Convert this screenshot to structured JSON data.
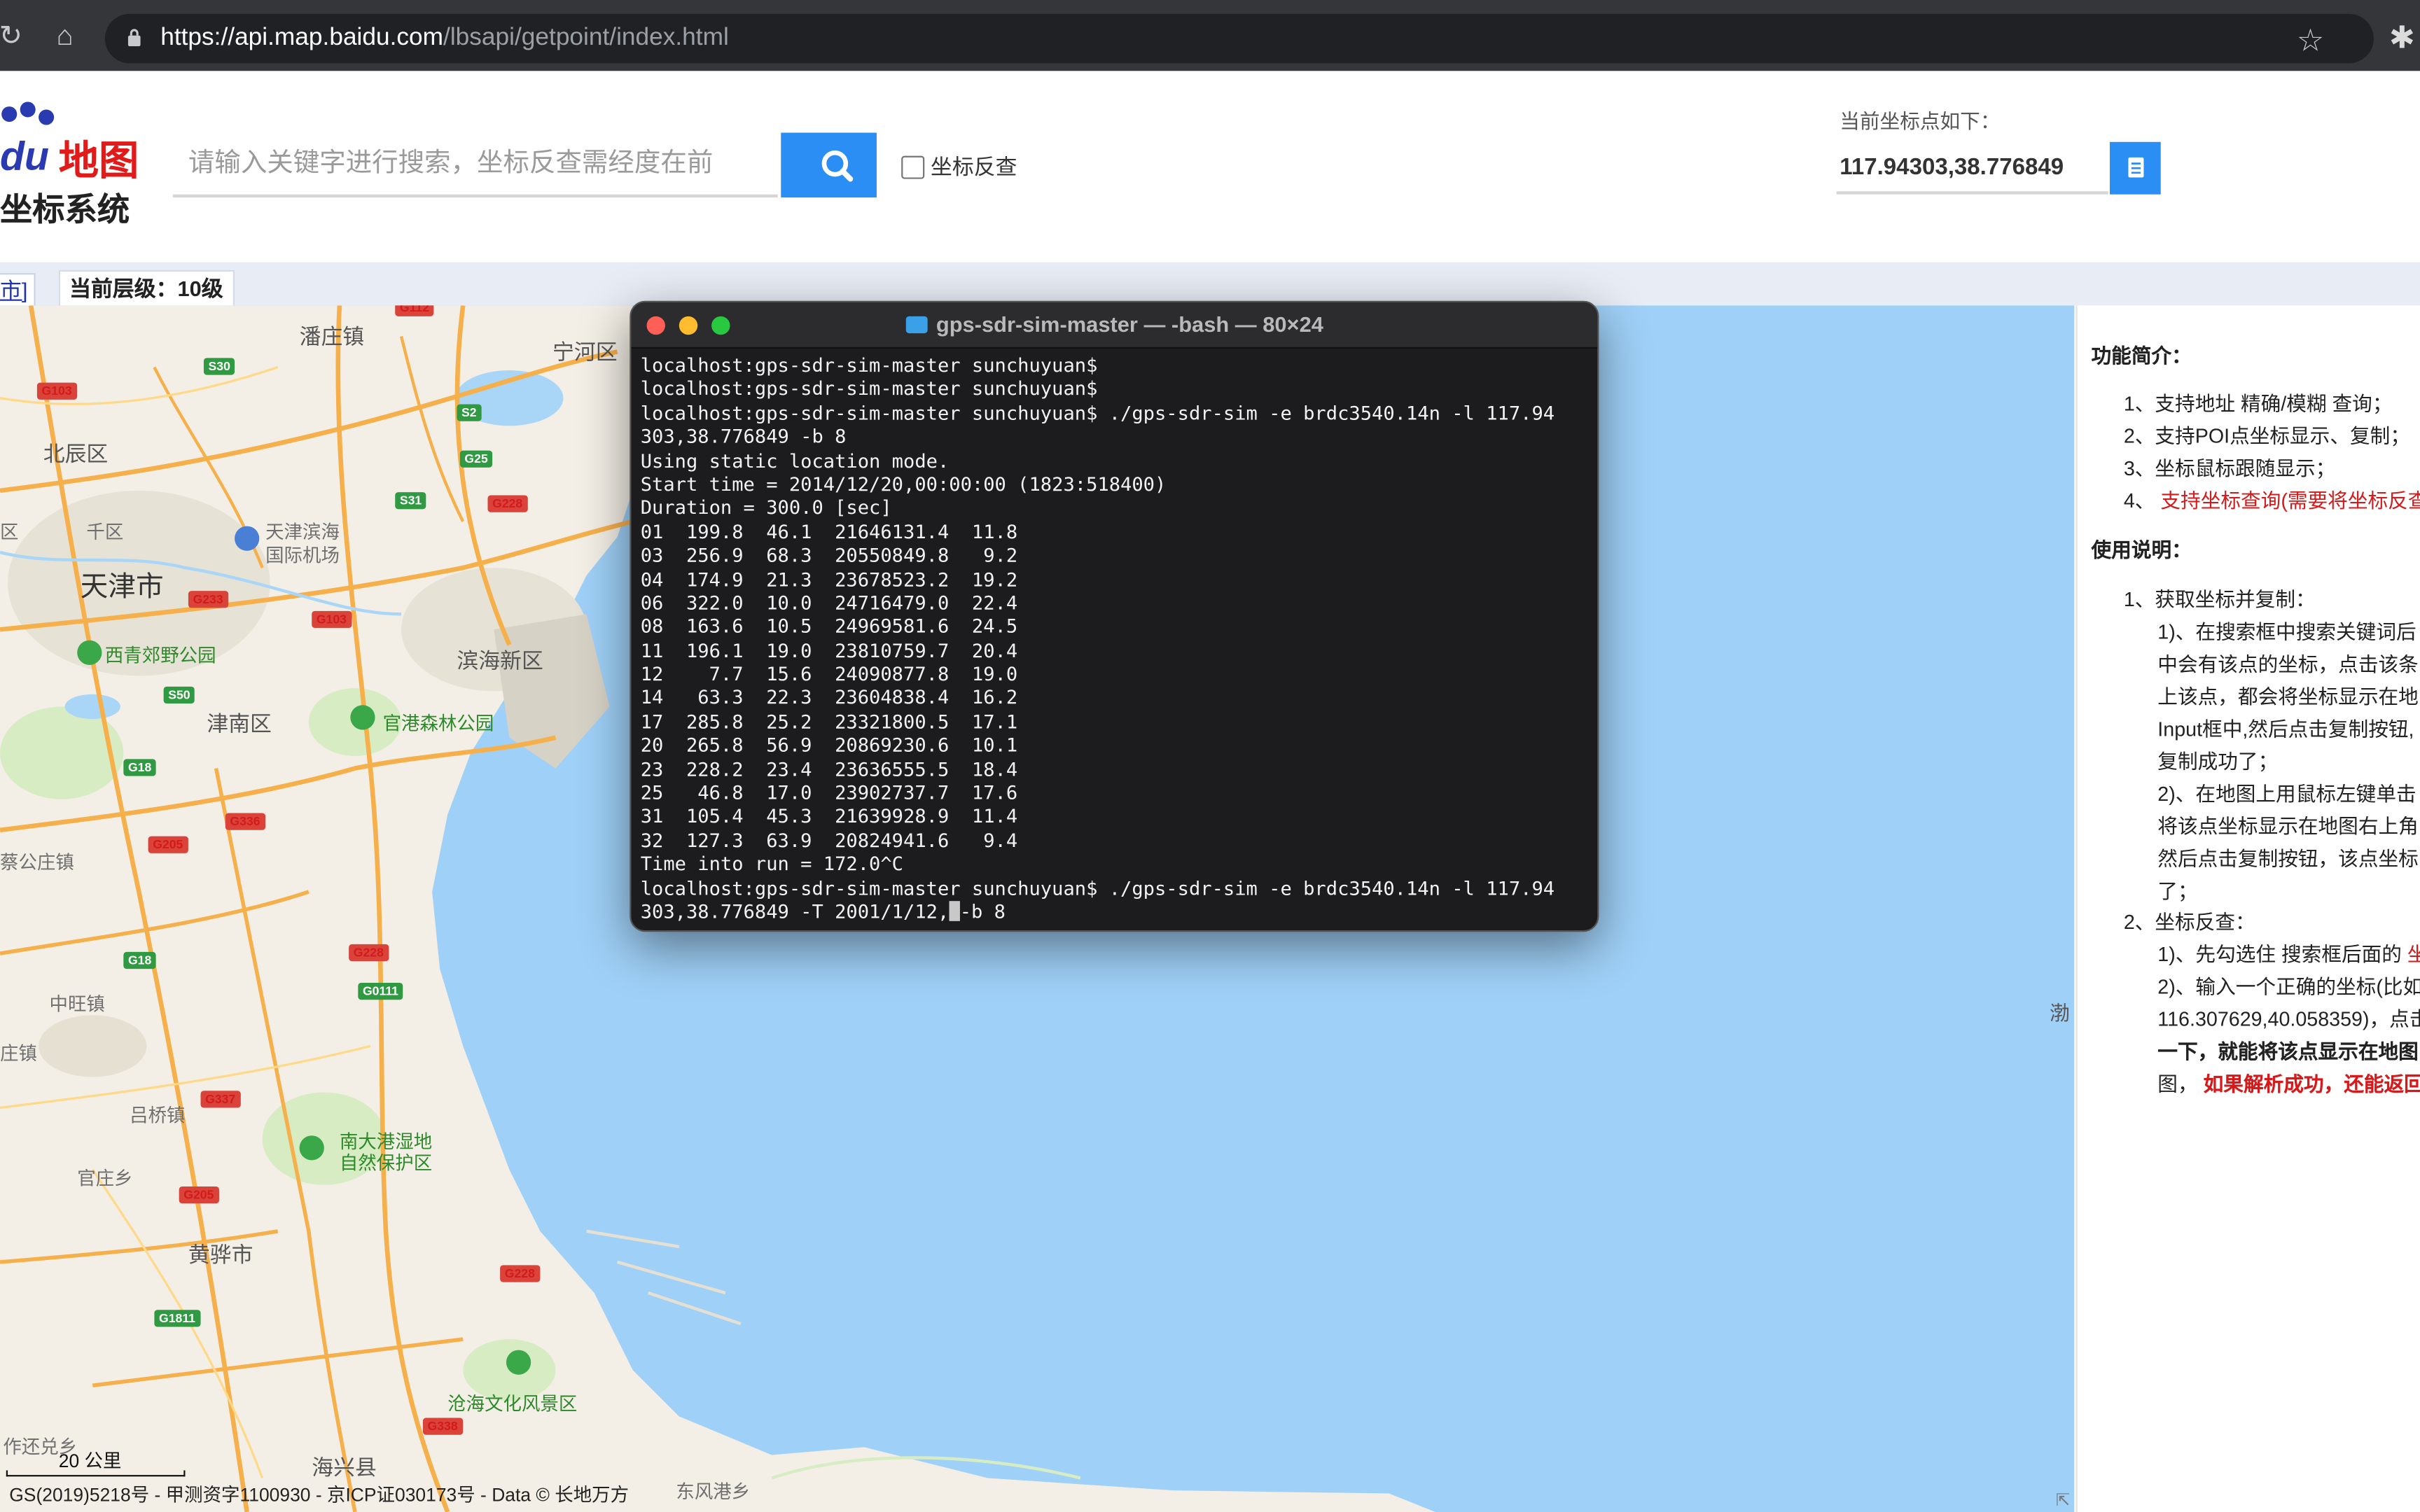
{
  "browser": {
    "url_domain": "https://api.map.baidu.com",
    "url_path": "/lbsapi/getpoint/index.html"
  },
  "header": {
    "logo_du": "du",
    "logo_map": "地图",
    "logo_sub": "坐标系统",
    "search_placeholder": "请输入关键字进行搜索，坐标反查需经度在前",
    "reverse_label": "坐标反查",
    "coord_title": "当前坐标点如下：",
    "coord_value": "117.94303,38.776849"
  },
  "levelbar": {
    "city_link": "市]",
    "level_label": "当前层级：10级"
  },
  "map": {
    "labels": {
      "tianjin": "天津市",
      "panzhuang": "潘庄镇",
      "ninghe": "宁河区",
      "beichen": "北辰区",
      "xiqing_area": "区",
      "gangu": "千区",
      "airport1": "天津滨海",
      "airport2": "国际机场",
      "xiqing_park": "西青郊野公园",
      "binhai": "滨海新区",
      "jinnan": "津南区",
      "guangang": "官港森林公园",
      "caigongzhuang": "蔡公庄镇",
      "zhongwang": "中旺镇",
      "zhen": "庄镇",
      "lvqiao": "吕桥镇",
      "nandagang1": "南大港湿地",
      "nandagang2": "自然保护区",
      "guanzhuang": "官庄乡",
      "huanghua": "黄骅市",
      "cangzhou_culture": "沧海文化风景区",
      "zuowang": "作还兑乡",
      "haixing": "海兴县",
      "fengang": "东风港乡"
    },
    "shields": [
      "G112",
      "S30",
      "G103",
      "S2",
      "G25",
      "S31",
      "G228",
      "G233",
      "G103",
      "S50",
      "G18",
      "G205",
      "G336",
      "G228",
      "G18",
      "G0111",
      "G337",
      "G205",
      "G228",
      "G1811",
      "G338"
    ],
    "scale_label": "20 公里",
    "copyright": "GS(2019)5218号 - 甲测资字1100930 - 京ICP证030173号 - Data © 长地万方",
    "bohai": "渤"
  },
  "terminal": {
    "title": "gps-sdr-sim-master — -bash — 80×24",
    "lines": [
      "localhost:gps-sdr-sim-master sunchuyuan$",
      "localhost:gps-sdr-sim-master sunchuyuan$",
      "localhost:gps-sdr-sim-master sunchuyuan$ ./gps-sdr-sim -e brdc3540.14n -l 117.94",
      "303,38.776849 -b 8",
      "Using static location mode.",
      "Start time = 2014/12/20,00:00:00 (1823:518400)",
      "Duration = 300.0 [sec]",
      "01  199.8  46.1  21646131.4  11.8",
      "03  256.9  68.3  20550849.8   9.2",
      "04  174.9  21.3  23678523.2  19.2",
      "06  322.0  10.0  24716479.0  22.4",
      "08  163.6  10.5  24969581.6  24.5",
      "11  196.1  19.0  23810759.7  20.4",
      "12    7.7  15.6  24090877.8  19.0",
      "14   63.3  22.3  23604838.4  16.2",
      "17  285.8  25.2  23321800.5  17.1",
      "20  265.8  56.9  20869230.6  10.1",
      "23  228.2  23.4  23636555.5  18.4",
      "25   46.8  17.0  23902737.7  17.6",
      "31  105.4  45.3  21639928.9  11.4",
      "32  127.3  63.9  20824941.6   9.4",
      "Time into run = 172.0^C",
      "localhost:gps-sdr-sim-master sunchuyuan$ ./gps-sdr-sim -e brdc3540.14n -l 117.94"
    ],
    "last_line_before": "303,38.776849 -T 2001/1/12,",
    "last_line_after": "-b 8"
  },
  "panel": {
    "intro_title": "功能简介：",
    "intro_1": "1、支持地址 精确/模糊 查询；",
    "intro_2": "2、支持POI点坐标显示、复制；",
    "intro_3": "3、坐标鼠标跟随显示；",
    "intro_4_num": "4、",
    "intro_4_text": "支持坐标查询(需要将坐标反查",
    "usage_title": "使用说明：",
    "u1": "1、获取坐标并复制：",
    "u1_1": "1)、在搜索框中搜索关键词后",
    "u1_2": "中会有该点的坐标，点击该条",
    "u1_3": "上该点，都会将坐标显示在地",
    "u1_4": "Input框中,然后点击复制按钮,",
    "u1_5": "复制成功了；",
    "u1_6": "2)、在地图上用鼠标左键单击",
    "u1_7": "将该点坐标显示在地图右上角",
    "u1_8": "然后点击复制按钮，该点坐标",
    "u1_9": "了；",
    "u2": "2、坐标反查：",
    "u2_1a": "1)、先勾选住 搜索框后面的 ",
    "u2_1b": "坐",
    "u2_2": "2)、输入一个正确的坐标(比如",
    "u2_3": "116.307629,40.058359)，点击",
    "u2_4": "一下，就能将该点显示在地图",
    "u2_5a": "图，",
    "u2_5b": "如果解析成功，还能返回"
  }
}
